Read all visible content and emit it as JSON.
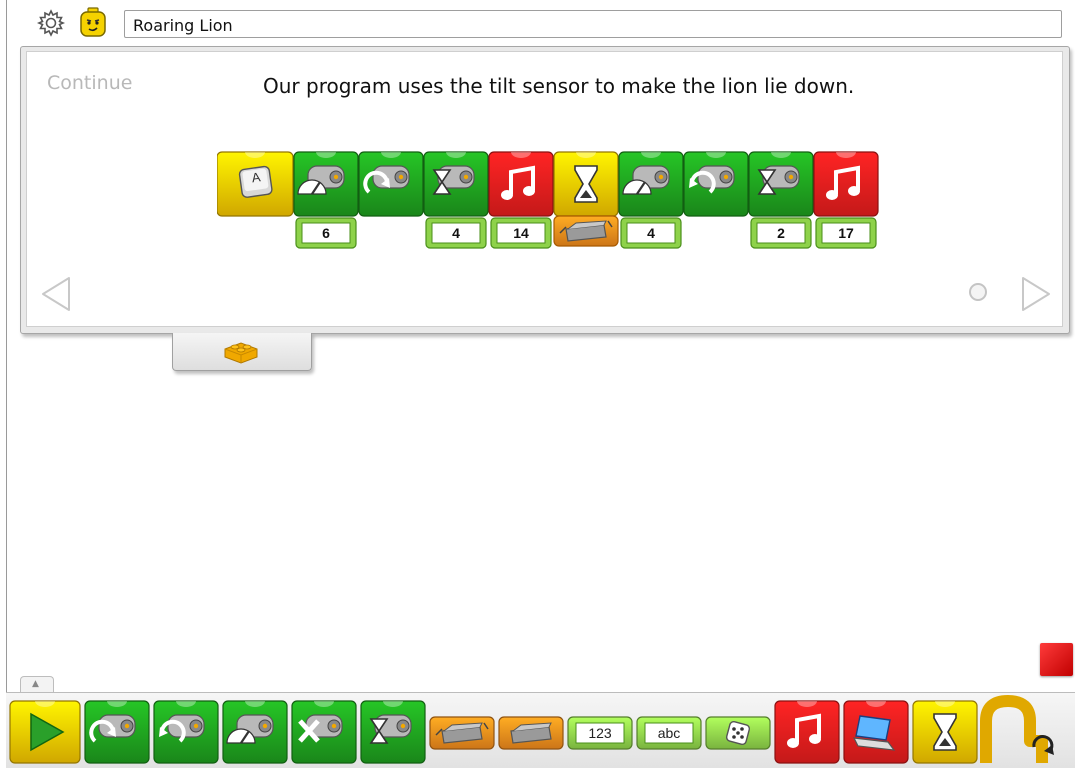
{
  "app": {
    "title": "Roaring Lion",
    "icons": [
      "gear-icon",
      "minifig-face-icon"
    ]
  },
  "panel": {
    "continue_label": "Continue",
    "description": "Our program uses the tilt sensor to make the lion lie down.",
    "program_blocks": [
      {
        "type": "start-on-key",
        "icon": "key-a-icon",
        "color": "#f5c400",
        "input": "",
        "letter": "A"
      },
      {
        "type": "motor-power",
        "icon": "motor-power-icon",
        "color": "#1e9e1e",
        "input": "6"
      },
      {
        "type": "motor-this-way",
        "icon": "motor-clockwise-icon",
        "color": "#1e9e1e",
        "input": ""
      },
      {
        "type": "motor-on-for",
        "icon": "motor-on-for-icon",
        "color": "#1e9e1e",
        "input": "4"
      },
      {
        "type": "play-sound",
        "icon": "sound-icon",
        "color": "#e61d1d",
        "input": "14"
      },
      {
        "type": "wait-for",
        "icon": "hourglass-icon",
        "color": "#f5c400",
        "input": "",
        "sensor": "tilt-sensor-icon"
      },
      {
        "type": "motor-power",
        "icon": "motor-power-icon",
        "color": "#1e9e1e",
        "input": "4"
      },
      {
        "type": "motor-that-way",
        "icon": "motor-counterclockwise-icon",
        "color": "#1e9e1e",
        "input": ""
      },
      {
        "type": "motor-on-for",
        "icon": "motor-on-for-icon",
        "color": "#1e9e1e",
        "input": "2"
      },
      {
        "type": "play-sound",
        "icon": "sound-icon",
        "color": "#e61d1d",
        "input": "17"
      }
    ],
    "nav": [
      "previous-arrow-icon",
      "page-dot-icon",
      "next-arrow-icon"
    ]
  },
  "palette": {
    "tab_symbol": "▲",
    "number_label": "123",
    "text_label": "abc",
    "blocks": [
      "start-icon",
      "motor-this-way-icon",
      "motor-that-way-icon",
      "motor-power-icon",
      "motor-off-icon",
      "motor-on-for-icon",
      "tilt-sensor-icon",
      "motion-sensor-icon",
      "number-input-icon",
      "text-input-icon",
      "random-icon",
      "sound-icon",
      "display-icon",
      "wait-icon",
      "repeat-icon"
    ]
  },
  "colors": {
    "green": "#1e9e1e",
    "red": "#e61d1d",
    "yellow": "#f5c400",
    "orange": "#f08a1c",
    "light_green": "#8ed24a"
  }
}
